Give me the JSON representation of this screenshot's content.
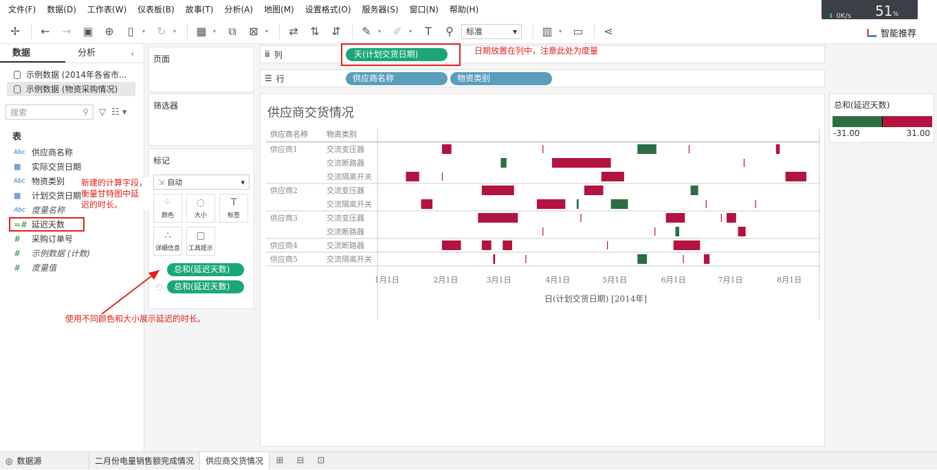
{
  "menu": [
    "文件(F)",
    "数据(D)",
    "工作表(W)",
    "仪表板(B)",
    "故事(T)",
    "分析(A)",
    "地图(M)",
    "设置格式(O)",
    "服务器(S)",
    "窗口(N)",
    "帮助(H)"
  ],
  "toolbar": {
    "fit_select": "标准",
    "smart_label": "智能推荐"
  },
  "network": {
    "speed": "0K/s",
    "percent": "51",
    "percent_unit": "%"
  },
  "left": {
    "tabs": [
      "数据",
      "分析"
    ],
    "datasources": [
      "示例数据 (2014年各省市...",
      "示例数据 (物资采购情况)"
    ],
    "search_placeholder": "搜索",
    "section": "表",
    "fields": [
      {
        "type": "Abc",
        "name": "供应商名称"
      },
      {
        "type": "cal",
        "name": "实际交货日期"
      },
      {
        "type": "Abc",
        "name": "物资类别"
      },
      {
        "type": "cal",
        "name": "计划交货日期"
      },
      {
        "type": "Abc",
        "name": "度量名称",
        "italic": true
      },
      {
        "type": "=#",
        "name": "延迟天数",
        "highlight": true
      },
      {
        "type": "#",
        "name": "采购订单号"
      },
      {
        "type": "#",
        "name": "示例数据 (计数)",
        "italic": true
      },
      {
        "type": "#",
        "name": "度量值",
        "italic": true
      }
    ]
  },
  "cards": {
    "pages": "页面",
    "filters": "筛选器",
    "marks": "标记",
    "mark_type": "自动",
    "mark_buttons": [
      "颜色",
      "大小",
      "标签",
      "详细信息",
      "工具提示"
    ],
    "mark_pills": [
      "总和(延迟天数)",
      "总和(延迟天数)"
    ]
  },
  "shelves": {
    "columns_label": "列",
    "rows_label": "行",
    "columns_pill": "天(计划交货日期)",
    "rows_pills": [
      "供应商名称",
      "物资类别"
    ]
  },
  "annotations": {
    "columns_note": "日期放置在列中，注意此处为度量",
    "calc_note": [
      "新建的计算字段，",
      "衡量甘特图中延",
      "迟的时长。"
    ],
    "marks_note": "使用不同颜色和大小展示延迟的时长。"
  },
  "legend": {
    "title": "总和(延迟天数)",
    "min": "-31.00",
    "max": "31.00",
    "neg_color": "#2b6e43",
    "pos_color": "#b3133f"
  },
  "chart_data": {
    "type": "gantt",
    "title": "供应商交货情况",
    "row_headers": [
      "供应商名称",
      "物资类别"
    ],
    "xlabel": "日(计划交货日期) [2014年]",
    "x_ticks": [
      "1月1日",
      "2月1日",
      "3月1日",
      "4月1日",
      "5月1日",
      "6月1日",
      "7月1日",
      "8月1日"
    ],
    "x_tick_days": [
      0,
      31,
      59,
      90,
      120,
      151,
      181,
      212
    ],
    "xlim": [
      -5,
      225
    ],
    "rows": [
      {
        "supplier": "供应商1",
        "category": "交流变压器",
        "bars": [
          {
            "start": 29,
            "delay": 5
          },
          {
            "start": 82,
            "delay": 0
          },
          {
            "start": 132,
            "delay": -10
          },
          {
            "start": 159,
            "delay": 0
          },
          {
            "start": 205,
            "delay": 2
          }
        ]
      },
      {
        "supplier": "",
        "category": "交流断路器",
        "bars": [
          {
            "start": 60,
            "delay": -3
          },
          {
            "start": 87,
            "delay": 31
          },
          {
            "start": 188,
            "delay": 0
          }
        ]
      },
      {
        "supplier": "",
        "category": "交流隔离开关",
        "bars": [
          {
            "start": 10,
            "delay": 7
          },
          {
            "start": 29,
            "delay": 0
          },
          {
            "start": 113,
            "delay": 12
          },
          {
            "start": 210,
            "delay": 11
          }
        ]
      },
      {
        "supplier": "供应商2",
        "category": "交流变压器",
        "bars": [
          {
            "start": 50,
            "delay": 17
          },
          {
            "start": 104,
            "delay": 10
          },
          {
            "start": 160,
            "delay": -4
          }
        ]
      },
      {
        "supplier": "",
        "category": "交流隔离开关",
        "bars": [
          {
            "start": 18,
            "delay": 6
          },
          {
            "start": 79,
            "delay": 15
          },
          {
            "start": 100,
            "delay": -1
          },
          {
            "start": 118,
            "delay": -9
          },
          {
            "start": 168,
            "delay": 0
          },
          {
            "start": 194,
            "delay": 0
          }
        ]
      },
      {
        "supplier": "供应商3",
        "category": "交流变压器",
        "bars": [
          {
            "start": 48,
            "delay": 21
          },
          {
            "start": 102,
            "delay": 0
          },
          {
            "start": 147,
            "delay": 10
          },
          {
            "start": 176,
            "delay": 0
          },
          {
            "start": 179,
            "delay": 5
          }
        ]
      },
      {
        "supplier": "",
        "category": "交流断路器",
        "bars": [
          {
            "start": 82,
            "delay": 0
          },
          {
            "start": 141,
            "delay": 0
          },
          {
            "start": 152,
            "delay": -2
          },
          {
            "start": 185,
            "delay": 4
          }
        ]
      },
      {
        "supplier": "供应商4",
        "category": "交流断路器",
        "bars": [
          {
            "start": 29,
            "delay": 10
          },
          {
            "start": 50,
            "delay": 5
          },
          {
            "start": 61,
            "delay": 5
          },
          {
            "start": 116,
            "delay": 0
          },
          {
            "start": 151,
            "delay": 14
          }
        ]
      },
      {
        "supplier": "供应商5",
        "category": "交流隔离开关",
        "bars": [
          {
            "start": 56,
            "delay": 1
          },
          {
            "start": 73,
            "delay": 0
          },
          {
            "start": 132,
            "delay": -5
          },
          {
            "start": 156,
            "delay": 0
          },
          {
            "start": 167,
            "delay": 3
          }
        ]
      }
    ]
  }
}
